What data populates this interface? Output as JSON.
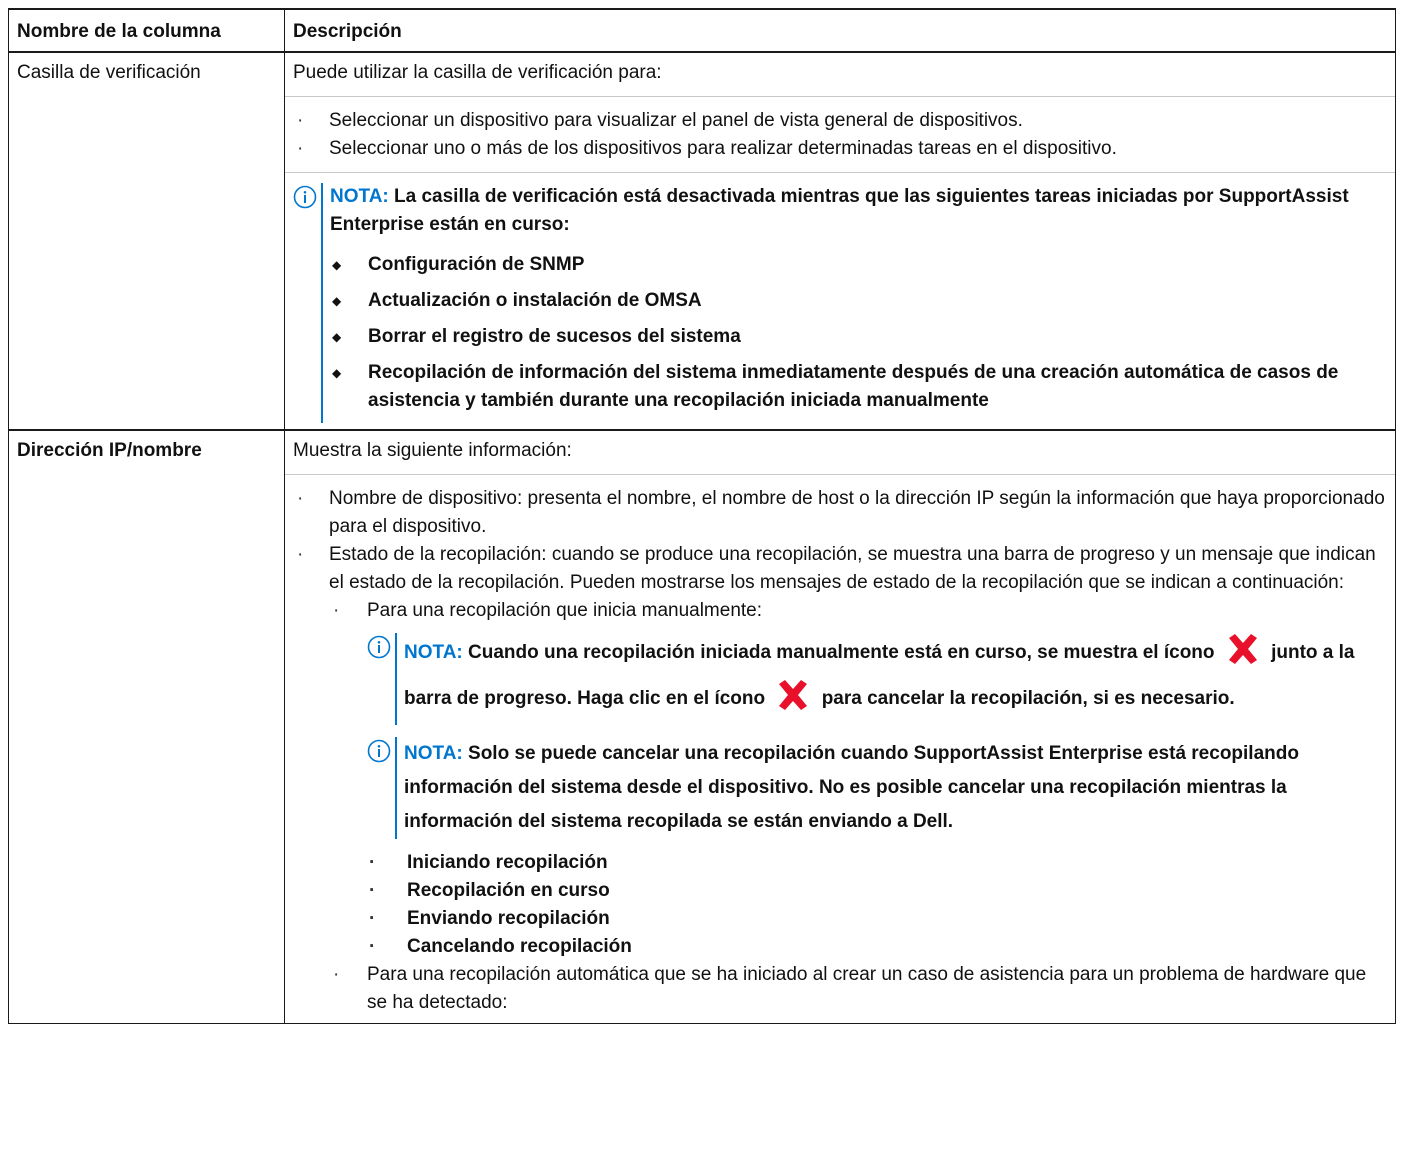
{
  "table": {
    "headers": [
      "Nombre de la columna",
      "Descripción"
    ],
    "row1": {
      "name": "Casilla de verificación",
      "intro": "Puede utilizar la casilla de verificación para:",
      "bullets": [
        "Seleccionar un dispositivo para visualizar el panel de vista general de dispositivos.",
        "Seleccionar uno o más de los dispositivos para realizar determinadas tareas en el dispositivo."
      ],
      "note": {
        "label": "NOTA:",
        "text": "La casilla de verificación está desactivada mientras que las siguientes tareas iniciadas por SupportAssist Enterprise están en curso:",
        "items": [
          "Configuración de SNMP",
          "Actualización o instalación de OMSA",
          "Borrar el registro de sucesos del sistema",
          "Recopilación de información del sistema inmediatamente después de una creación automática de casos de asistencia y también durante una recopilación iniciada manualmente"
        ]
      }
    },
    "row2": {
      "name": "Dirección IP/nombre",
      "intro": "Muestra la siguiente información:",
      "bullet1": "Nombre de dispositivo: presenta el nombre, el nombre de host o la dirección IP según la información que haya proporcionado para el dispositivo.",
      "bullet2": "Estado de la recopilación: cuando se produce una recopilación, se muestra una barra de progreso y un mensaje que indican el estado de la recopilación. Pueden mostrarse los mensajes de estado de la recopilación que se indican a continuación:",
      "sub1": "Para una recopilación que inicia manualmente:",
      "note1": {
        "label": "NOTA:",
        "part1": "Cuando una recopilación iniciada manualmente está en curso, se muestra el ícono",
        "part2": "junto a la barra de progreso. Haga clic en el ícono",
        "part3": "para cancelar la recopilación, si es necesario."
      },
      "note2": {
        "label": "NOTA:",
        "text": "Solo se puede cancelar una recopilación cuando SupportAssist Enterprise está recopilando información del sistema desde el dispositivo. No es posible cancelar una recopilación mientras la información del sistema recopilada se están enviando a Dell."
      },
      "statuses": [
        "Iniciando recopilación",
        "Recopilación en curso",
        "Enviando recopilación",
        "Cancelando recopilación"
      ],
      "sub2": "Para una recopilación automática que se ha iniciado al crear un caso de asistencia para un problema de hardware que se ha detectado:"
    },
    "icons": {
      "info": "info-circle-icon",
      "cancel": "red-x-icon"
    },
    "colors": {
      "accent": "#0076ce",
      "cancel_red": "#e8102a"
    }
  }
}
